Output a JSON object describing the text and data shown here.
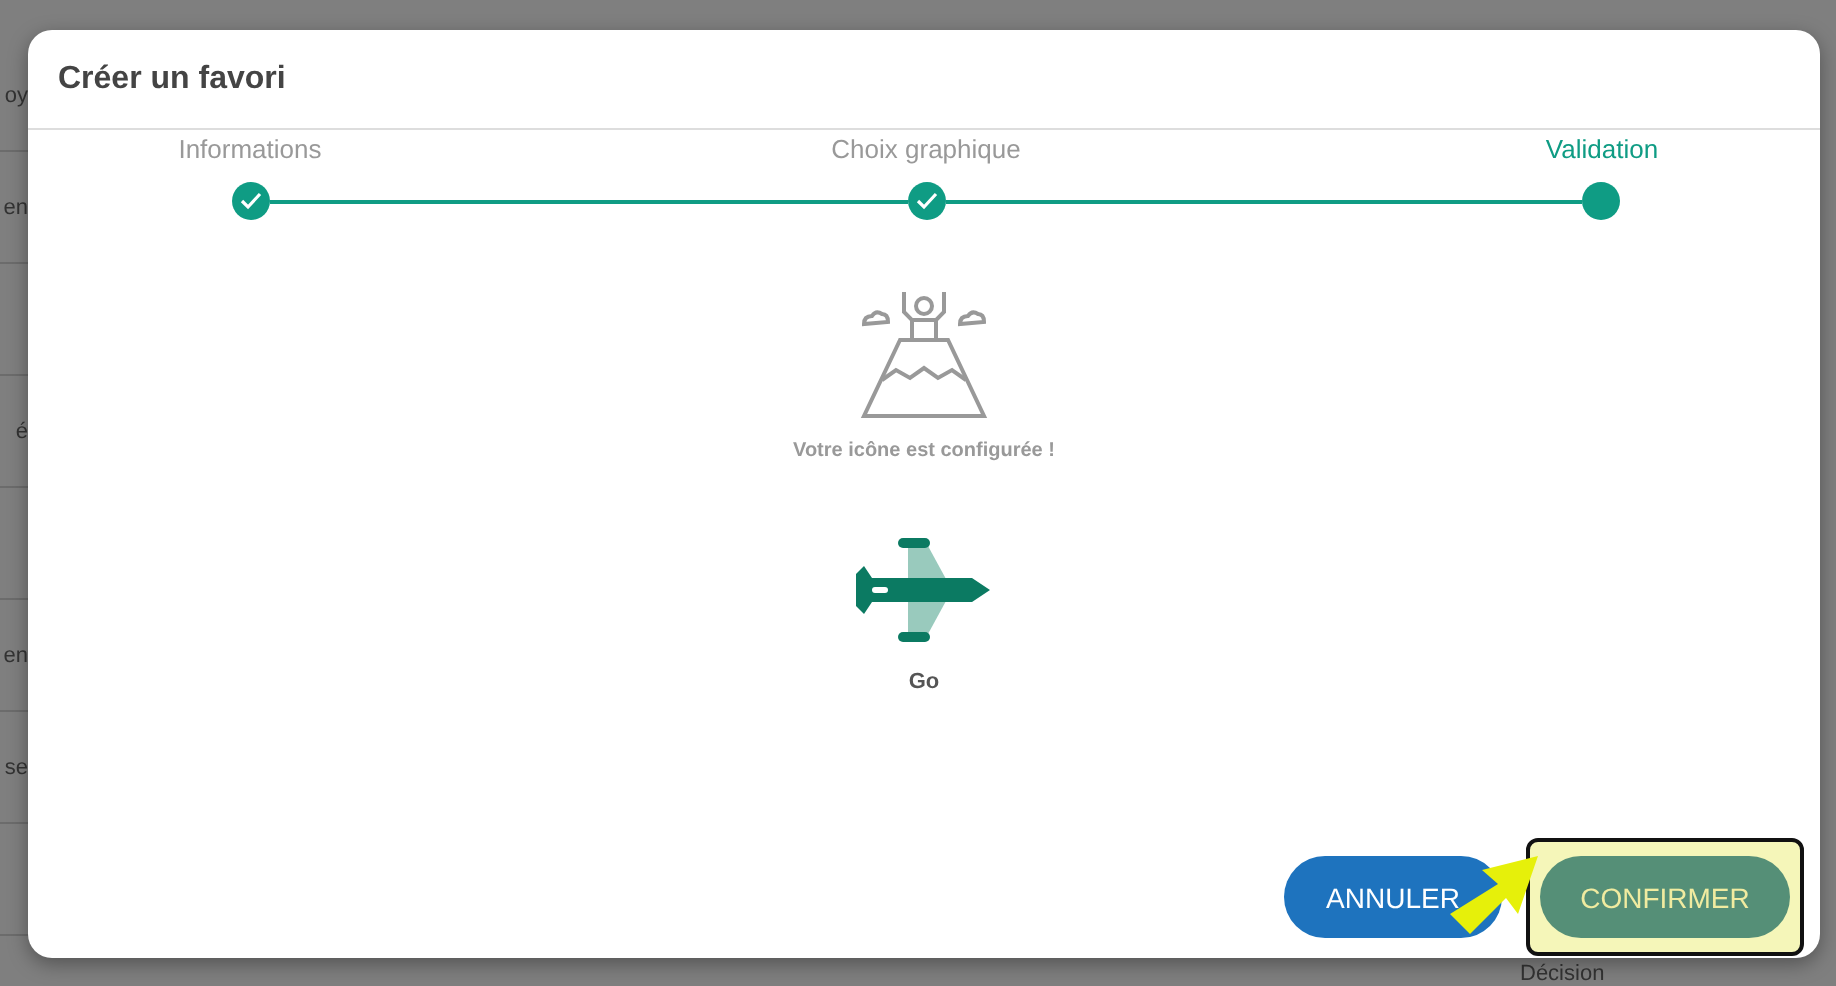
{
  "background": {
    "rows": [
      "oy",
      "en",
      "",
      "é",
      "",
      "en",
      "se",
      ""
    ],
    "footer_text": "Décision"
  },
  "dialog": {
    "title": "Créer un favori",
    "steps": [
      {
        "label": "Informations",
        "completed": true,
        "selected": false
      },
      {
        "label": "Choix graphique",
        "completed": true,
        "selected": false
      },
      {
        "label": "Validation",
        "completed": false,
        "selected": true
      }
    ],
    "message": "Votre icône est configurée !",
    "favorite_name": "Go",
    "buttons": [
      {
        "label": "ANNULER",
        "kind": "cancel",
        "highlighted": false
      },
      {
        "label": "CONFIRMER",
        "kind": "confirm",
        "highlighted": true
      }
    ]
  }
}
